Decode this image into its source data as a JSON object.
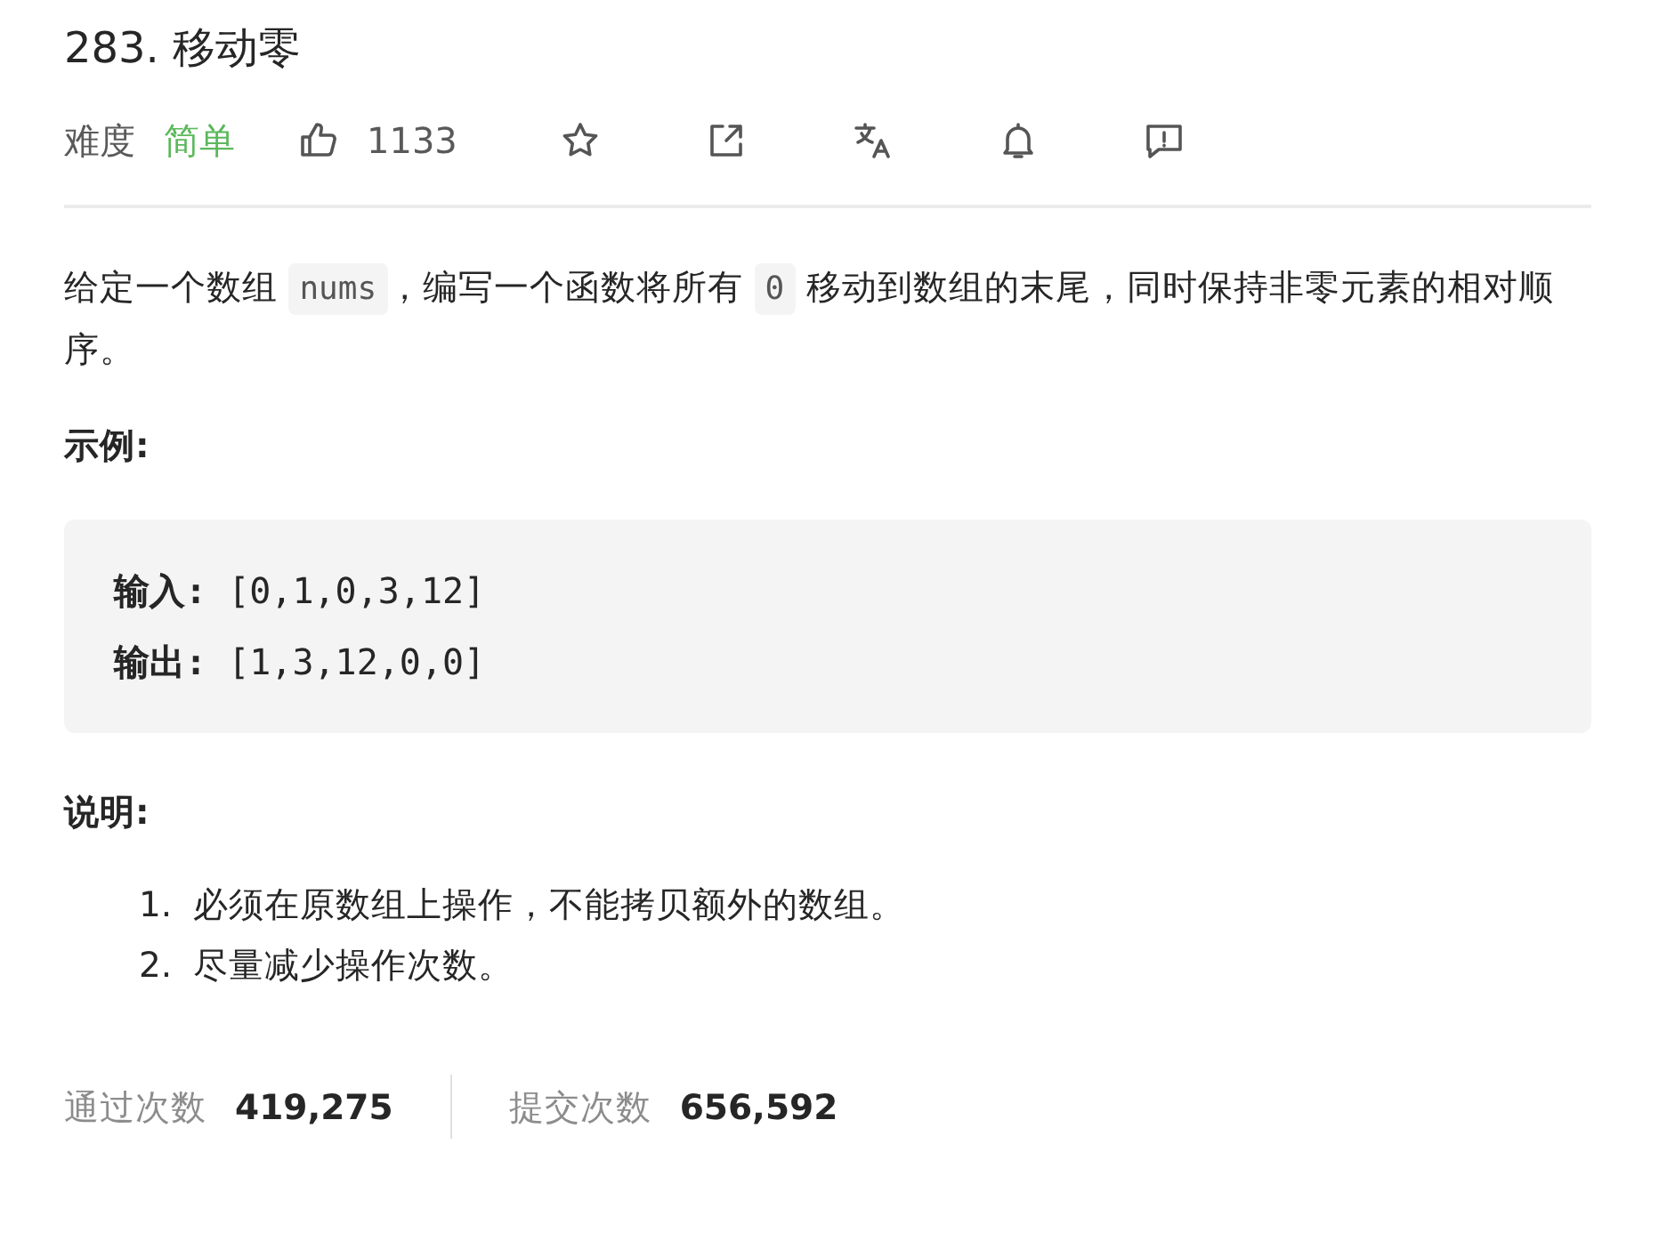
{
  "problem": {
    "title": "283. 移动零"
  },
  "meta": {
    "difficulty_label": "难度",
    "difficulty": {
      "value": "简单",
      "kind": "easy"
    },
    "actions": [
      {
        "kind": "like",
        "count": "1133"
      },
      {
        "kind": "star"
      },
      {
        "kind": "share"
      },
      {
        "kind": "translate"
      },
      {
        "kind": "bell"
      },
      {
        "kind": "feedback"
      }
    ]
  },
  "description": [
    {
      "kind": "text",
      "text": "给定一个数组 "
    },
    {
      "kind": "code",
      "text": "nums"
    },
    {
      "kind": "text",
      "text": "，编写一个函数将所有 "
    },
    {
      "kind": "code",
      "text": "0"
    },
    {
      "kind": "text",
      "text": " 移动到数组的末尾，同时保持非零元素的相对顺序。"
    }
  ],
  "example": {
    "heading": "示例:",
    "lines": [
      "**输入:** [0,1,0,3,12]",
      "**输出:** [1,3,12,0,0]"
    ]
  },
  "notes": {
    "heading": "说明:",
    "items": [
      {
        "number": "1.",
        "text": "必须在原数组上操作，不能拷贝额外的数组。"
      },
      {
        "number": "2.",
        "text": "尽量减少操作次数。"
      }
    ]
  },
  "stats": [
    {
      "label": "通过次数",
      "value": "419,275"
    },
    {
      "label": "提交次数",
      "value": "656,592"
    }
  ]
}
